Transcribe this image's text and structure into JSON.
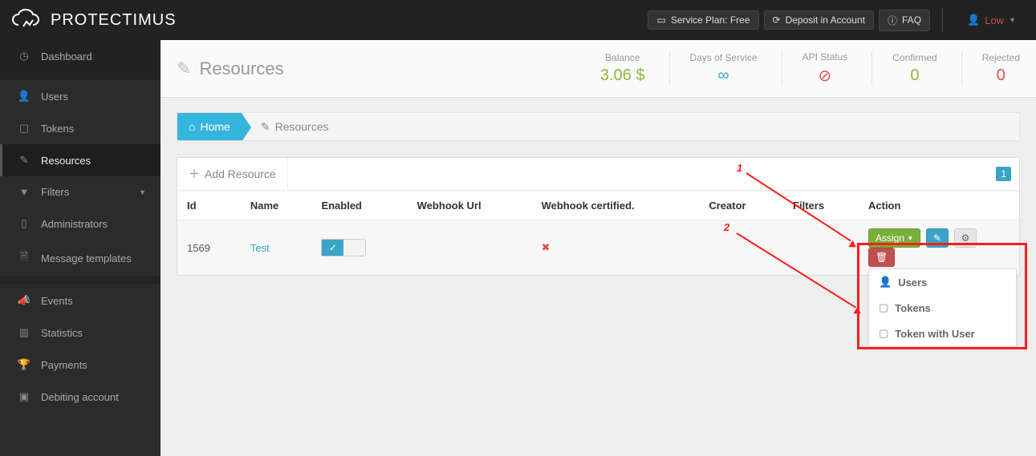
{
  "brand": "PROTECTIMUS",
  "header": {
    "service_plan": "Service Plan: Free",
    "deposit": "Deposit in Account",
    "faq": "FAQ",
    "user": "Low"
  },
  "sidebar": {
    "items": [
      {
        "label": "Dashboard"
      },
      {
        "label": "Users"
      },
      {
        "label": "Tokens"
      },
      {
        "label": "Resources"
      },
      {
        "label": "Filters"
      },
      {
        "label": "Administrators"
      },
      {
        "label": "Message templates"
      },
      {
        "label": "Events"
      },
      {
        "label": "Statistics"
      },
      {
        "label": "Payments"
      },
      {
        "label": "Debiting account"
      }
    ]
  },
  "page": {
    "title": "Resources",
    "breadcrumb_home": "Home",
    "breadcrumb_current": "Resources",
    "add_btn": "Add Resource",
    "page_num": "1"
  },
  "kpis": [
    {
      "label": "Balance",
      "value": "3.06 $",
      "cls": "val-green"
    },
    {
      "label": "Days of Service",
      "value": "∞",
      "cls": "val-blue"
    },
    {
      "label": "API Status",
      "value": "⊘",
      "cls": "val-red"
    },
    {
      "label": "Confirmed",
      "value": "0",
      "cls": "val-green"
    },
    {
      "label": "Rejected",
      "value": "0",
      "cls": "val-red"
    }
  ],
  "table": {
    "columns": [
      "Id",
      "Name",
      "Enabled",
      "Webhook Url",
      "Webhook certified.",
      "Creator",
      "Filters",
      "Action"
    ],
    "rows": [
      {
        "id": "1569",
        "name": "Test",
        "enabled": true,
        "webhook_url": "",
        "webhook_cert": false,
        "creator": "",
        "filters": ""
      }
    ]
  },
  "actions": {
    "assign": "Assign",
    "dropdown": [
      "Users",
      "Tokens",
      "Token with User"
    ]
  },
  "annot": {
    "one": "1",
    "two": "2"
  }
}
